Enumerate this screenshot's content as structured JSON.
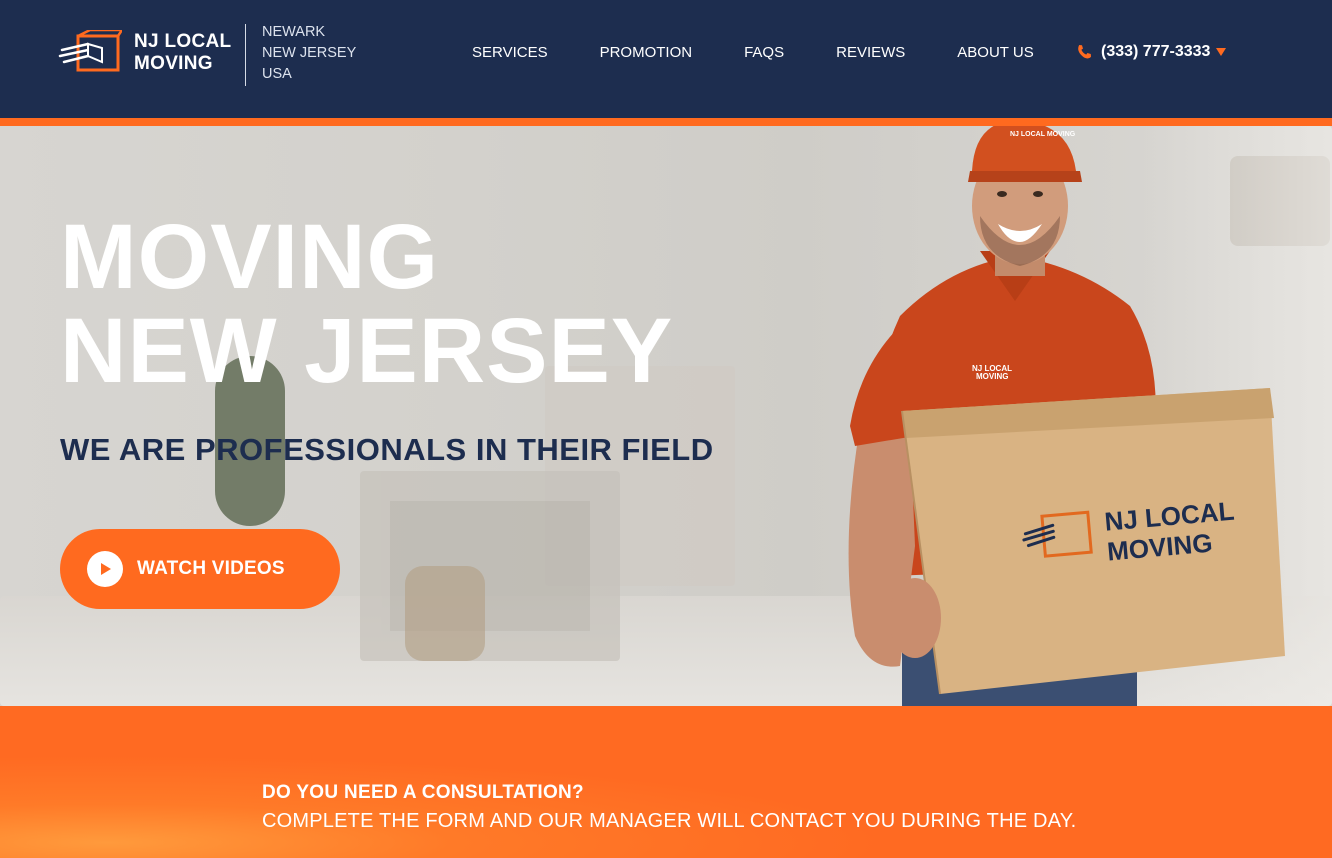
{
  "header": {
    "logo_line1": "NJ LOCAL",
    "logo_line2": "MOVING",
    "location": [
      "NEWARK",
      "NEW JERSEY",
      "USA"
    ],
    "nav": [
      "SERVICES",
      "PROMOTION",
      "FAQS",
      "REVIEWS",
      "ABOUT US"
    ],
    "phone": "(333) 777-3333",
    "phone_icon": "phone-icon",
    "dropdown_icon": "caret-down-icon"
  },
  "hero": {
    "title_line1": "MOVING",
    "title_line2": "NEW JERSEY",
    "subtitle": "WE ARE PROFESSIONALS IN THEIR FIELD",
    "watch_button": "WATCH VIDEOS",
    "cap_logo": "NJ LOCAL MOVING",
    "shirt_logo_line1": "NJ LOCAL",
    "shirt_logo_line2": "MOVING",
    "box_logo_line1": "NJ LOCAL",
    "box_logo_line2": "MOVING"
  },
  "consultation": {
    "question": "DO YOU NEED A CONSULTATION?",
    "description": "COMPLETE THE FORM AND OUR MANAGER WILL CONTACT YOU DURING THE DAY."
  },
  "colors": {
    "navy": "#1d2d4f",
    "orange": "#ff6a1f",
    "white": "#ffffff"
  }
}
